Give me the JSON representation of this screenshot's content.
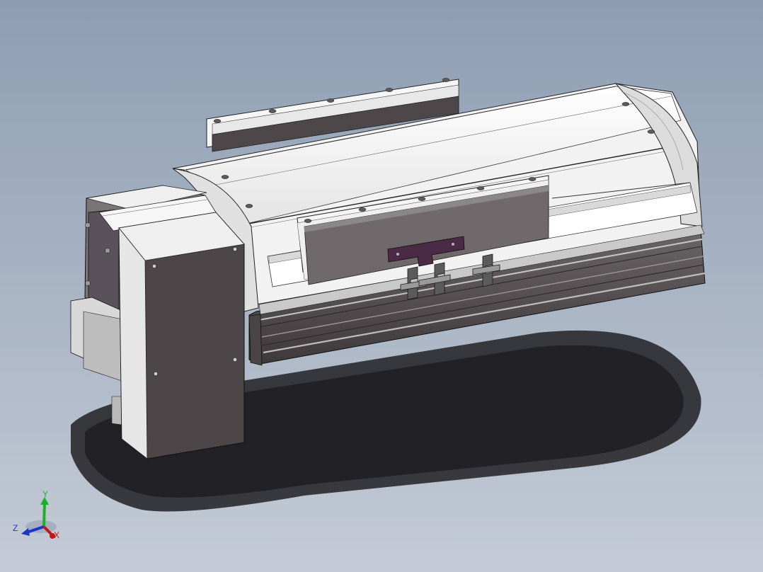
{
  "viewport": {
    "background_top": "#8d9db2",
    "background_bottom": "#c4cbd6"
  },
  "model": {
    "body_color": "#f4f4f4",
    "side_color": "#4d4649",
    "side_light": "#8e8a8c",
    "bracket_color": "#4a2a44",
    "shadow_color": "#2a2a2e"
  },
  "triad": {
    "x_label": "X",
    "y_label": "Y",
    "z_label": "Z",
    "x_color": "#c41616",
    "y_color": "#1fae2a",
    "z_color": "#2233c8"
  }
}
